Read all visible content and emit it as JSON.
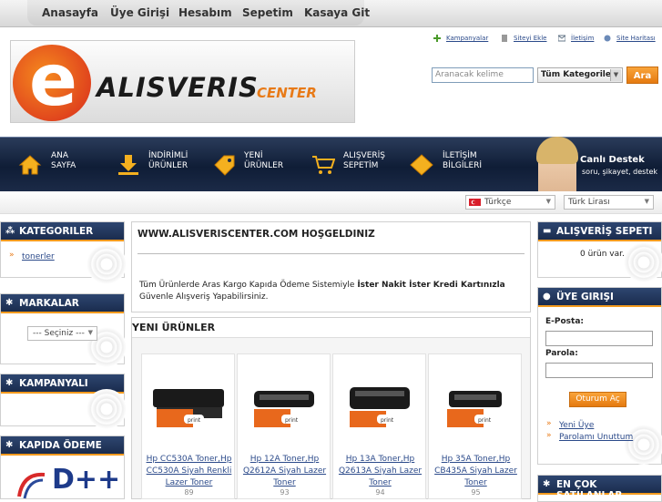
{
  "top_nav": [
    "Anasayfa",
    "Üye Girişi",
    "Hesabım",
    "Sepetim",
    "Kasaya Git"
  ],
  "logo": {
    "letter": "e",
    "word": "ALISVERIS",
    "sub": "CENTER"
  },
  "top_links": [
    "Kampanyalar",
    "Siteyi Ekle",
    "İletişim",
    "Site Haritası"
  ],
  "search": {
    "placeholder": "Aranacak kelime",
    "category": "Tüm Kategoriler",
    "button": "Ara"
  },
  "banner_items": [
    {
      "line1": "ANA",
      "line2": "SAYFA"
    },
    {
      "line1": "İNDİRİMLİ",
      "line2": "ÜRÜNLER"
    },
    {
      "line1": "YENİ",
      "line2": "ÜRÜNLER"
    },
    {
      "line1": "ALIŞVERİŞ",
      "line2": "SEPETİM"
    },
    {
      "line1": "İLETİŞİM",
      "line2": "BİLGİLERİ"
    }
  ],
  "support": {
    "title": "Canlı Destek",
    "subtitle": "soru, şikayet, destek"
  },
  "language": "Türkçe",
  "currency": "Türk Lirası",
  "left": {
    "categories_title": "KATEGORILER",
    "category_items": [
      "tonerler"
    ],
    "brands_title": "MARKALAR",
    "brand_select": "--- Seçiniz ---",
    "campaign_title": "KAMPANYALI",
    "cod_title": "KAPIDA ÖDEME",
    "cod_logo": "D++"
  },
  "main": {
    "welcome_title": "WWW.ALISVERISCENTER.COM HOŞGELDINIZ",
    "welcome_text_1": "Tüm Ürünlerde Aras Kargo Kapıda Ödeme Sistemiyle ",
    "welcome_bold": "İster Nakit İster Kredi Kartınızla",
    "welcome_text_2": " Güvenle Alışveriş Yapabilirsiniz.",
    "new_products_title": "YENI ÜRÜNLER",
    "products": [
      {
        "name": "Hp CC530A Toner,Hp CC530A Siyah Renkli Lazer Toner",
        "id": "89"
      },
      {
        "name": "Hp 12A Toner,Hp Q2612A Siyah Lazer Toner",
        "id": "93"
      },
      {
        "name": "Hp 13A Toner,Hp Q2613A Siyah Lazer Toner",
        "id": "94"
      },
      {
        "name": "Hp 35A Toner,Hp CB435A Siyah Lazer Toner",
        "id": "95"
      }
    ]
  },
  "right": {
    "cart_title": "ALIŞVERİŞ SEPETI",
    "cart_text": "0 ürün var.",
    "login_title": "ÜYE GIRIŞI",
    "email_label": "E-Posta:",
    "password_label": "Parola:",
    "login_button": "Oturum Aç",
    "links": [
      "Yeni Üye",
      "Parolamı Unuttum"
    ],
    "bestseller_title": "EN ÇOK SATILANLAR"
  }
}
